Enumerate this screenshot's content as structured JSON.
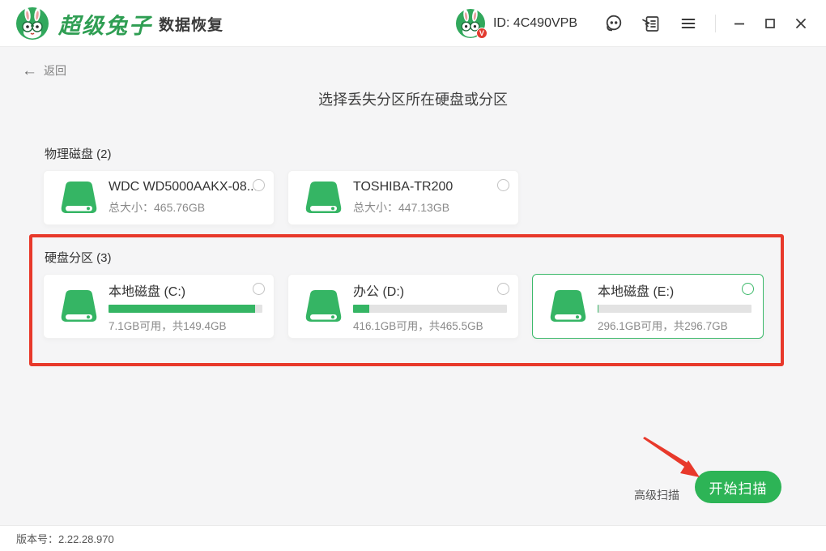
{
  "titlebar": {
    "brand": "超级兔子",
    "product": "数据恢复",
    "user_id": "ID: 4C490VPB",
    "icons": [
      "rabbit-logo",
      "avatar-rabbit-v-badge",
      "support-headset-icon",
      "feedback-form-icon",
      "menu-icon",
      "minimize-icon",
      "maximize-icon",
      "close-icon"
    ]
  },
  "nav": {
    "back": "返回"
  },
  "page": {
    "title": "选择丢失分区所在硬盘或分区"
  },
  "physical_disks": {
    "title": "物理磁盘 (2)",
    "items": [
      {
        "name": "WDC WD5000AAKX-08...",
        "info": "总大小：465.76GB",
        "selected": false
      },
      {
        "name": "TOSHIBA-TR200",
        "info": "总大小：447.13GB",
        "selected": false
      }
    ]
  },
  "partitions": {
    "title": "硬盘分区 (3)",
    "items": [
      {
        "name": "本地磁盘 (C:)",
        "info": "7.1GB可用，共149.4GB",
        "used_pct": 95.2,
        "selected": false
      },
      {
        "name": "办公 (D:)",
        "info": "416.1GB可用，共465.5GB",
        "used_pct": 10.6,
        "selected": false
      },
      {
        "name": "本地磁盘 (E:)",
        "info": "296.1GB可用，共296.7GB",
        "used_pct": 0.5,
        "selected": true
      }
    ]
  },
  "actions": {
    "advanced": "高级扫描",
    "start": "开始扫描"
  },
  "footer": {
    "version": "版本号：2.22.28.970"
  },
  "annotations": {
    "highlight_rect": "partition-section",
    "arrow_target": "start-scan-button"
  },
  "colors": {
    "brand_green": "#2f9e53",
    "icon_green": "#35b564",
    "button_green": "#2db456",
    "annotation_red": "#e8392b",
    "selected_border": "#3cb96a"
  }
}
